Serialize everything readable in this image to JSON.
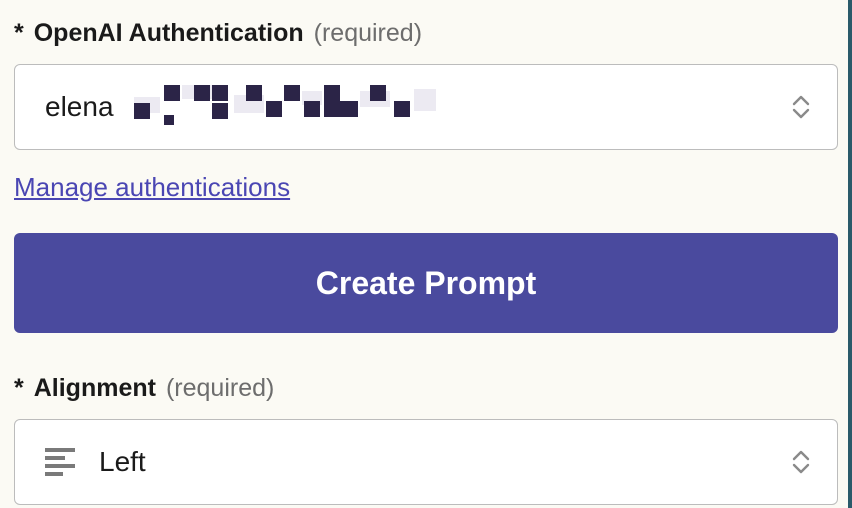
{
  "auth": {
    "required_marker": "*",
    "label": "OpenAI Authentication",
    "required_text": "(required)",
    "selected_value": "elena",
    "manage_link": "Manage authentications"
  },
  "create_button": "Create Prompt",
  "alignment": {
    "required_marker": "*",
    "label": "Alignment",
    "required_text": "(required)",
    "selected_value": "Left"
  },
  "icons": {
    "select_stepper": "chevron-up-down-icon",
    "align_left": "align-left-icon"
  },
  "colors": {
    "accent": "#4a4a9e",
    "link": "#4a46b3",
    "bg": "#fbfaf4"
  }
}
